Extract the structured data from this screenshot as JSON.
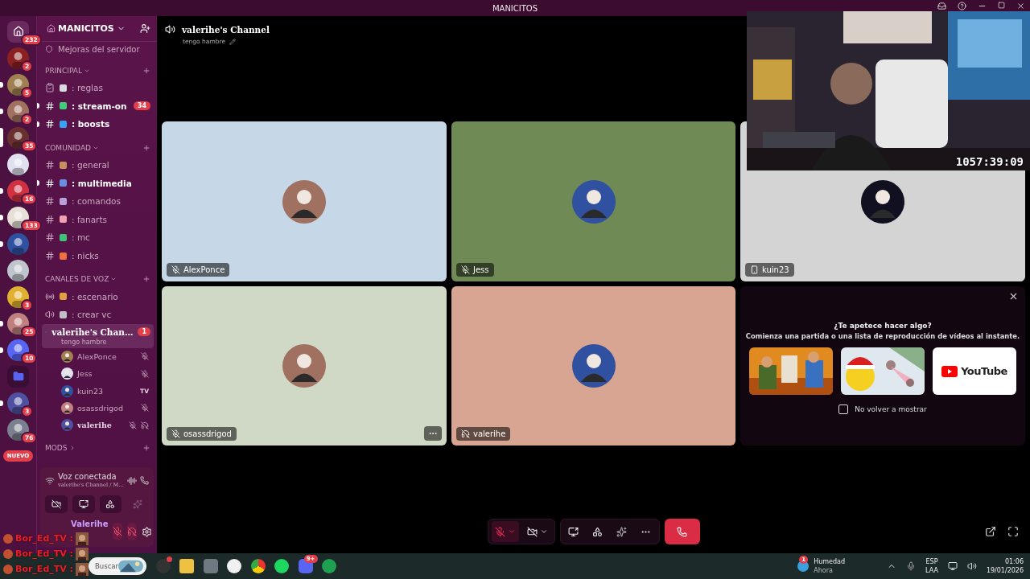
{
  "title_bar": {
    "title": "MANICITOS"
  },
  "servers": [
    {
      "kind": "home",
      "badge": "232",
      "unread": false,
      "selected": false
    },
    {
      "kind": "server",
      "badge": "2",
      "unread": false,
      "selected": false
    },
    {
      "kind": "server",
      "badge": "5",
      "unread": true,
      "selected": false
    },
    {
      "kind": "server",
      "badge": "2",
      "unread": true,
      "selected": false
    },
    {
      "kind": "server",
      "badge": "35",
      "unread": false,
      "selected": true
    },
    {
      "kind": "server",
      "unread": false,
      "selected": false
    },
    {
      "kind": "server",
      "badge": "16",
      "unread": true,
      "selected": false
    },
    {
      "kind": "server",
      "badge": "133",
      "unread": true,
      "selected": false
    },
    {
      "kind": "server",
      "unread": true,
      "selected": false
    },
    {
      "kind": "server",
      "unread": false,
      "selected": false
    },
    {
      "kind": "server",
      "badge": "3",
      "unread": false,
      "selected": false
    },
    {
      "kind": "server",
      "badge": "25",
      "unread": true,
      "selected": false
    },
    {
      "kind": "server",
      "badge": "10",
      "unread": true,
      "selected": false
    },
    {
      "kind": "folder",
      "unread": false,
      "selected": false
    },
    {
      "kind": "server",
      "badge": "3",
      "unread": true,
      "selected": false
    },
    {
      "kind": "server",
      "badge": "76",
      "unread": false,
      "selected": false
    },
    {
      "kind": "new",
      "label": "NUEVO",
      "unread": false,
      "selected": false
    }
  ],
  "server_header": {
    "name": "MANICITOS",
    "boost_link": "Mejoras del servidor"
  },
  "categories": [
    {
      "name": "PRINCIPAL",
      "expanded": true,
      "channels": [
        {
          "kind": "rules",
          "name": ": reglas",
          "color": "#d9d9e0",
          "unread": false
        },
        {
          "kind": "text",
          "name": ": stream-on",
          "color": "#3fcf7a",
          "unread": true,
          "badge": "34"
        },
        {
          "kind": "text",
          "name": ": boosts",
          "color": "#3aa0f0",
          "unread": true
        }
      ]
    },
    {
      "name": "COMUNIDAD",
      "expanded": true,
      "channels": [
        {
          "kind": "text",
          "name": ": general",
          "color": "#c8905a",
          "unread": false
        },
        {
          "kind": "text",
          "name": ": multimedia",
          "color": "#6b8fe0",
          "unread": true
        },
        {
          "kind": "text",
          "name": ": comandos",
          "color": "#b8a0d8",
          "unread": false
        },
        {
          "kind": "text",
          "name": ": fanarts",
          "color": "#f0a0b0",
          "unread": false
        },
        {
          "kind": "text",
          "name": ": mc",
          "color": "#3ec27a",
          "unread": false
        },
        {
          "kind": "text",
          "name": ": nicks",
          "color": "#f07040",
          "unread": false
        }
      ]
    },
    {
      "name": "CANALES DE VOZ",
      "expanded": true,
      "channels": [
        {
          "kind": "stage",
          "name": ": escenario",
          "color": "#e0a040",
          "unread": false
        },
        {
          "kind": "voice",
          "name": ": crear vc",
          "color": "#c0c0c8",
          "unread": false
        },
        {
          "kind": "voice",
          "name": "valerihe's Chan…",
          "selected": true,
          "badge": "1",
          "status": "tengo hambre",
          "unread": false,
          "members": [
            {
              "name": "AlexPonce",
              "muted": true,
              "deafened": false
            },
            {
              "name": "Jess",
              "muted": true,
              "deafened": false
            },
            {
              "name": "kuin23",
              "tag": "TV",
              "muted": false,
              "deafened": false
            },
            {
              "name": "osassdrigod",
              "muted": true,
              "deafened": false
            },
            {
              "name": "valerihe",
              "muted": true,
              "deafened": true
            }
          ]
        }
      ]
    },
    {
      "name": "MODS",
      "expanded": false
    }
  ],
  "voice_panel": {
    "status": "Voz conectada",
    "channel": "valerihe's Channel / M…"
  },
  "user_panel": {
    "name": "Valerihe",
    "muted": true,
    "deafened": true
  },
  "channel_header": {
    "name": "valerihe's Channel",
    "status": "tengo hambre"
  },
  "tiles": [
    {
      "name": "AlexPonce",
      "kind": "muted",
      "color": "#c6d7e7",
      "more": false
    },
    {
      "name": "Jess",
      "kind": "muted",
      "color": "#6f8a54",
      "more": false
    },
    {
      "name": "kuin23",
      "kind": "mobile",
      "color": "#d4d4d4",
      "more": false
    },
    {
      "name": "osassdrigod",
      "kind": "muted",
      "color": "#d0d9c5",
      "more": true
    },
    {
      "name": "valerihe",
      "kind": "deafened",
      "color": "#d8a593",
      "more": false
    }
  ],
  "activity_panel": {
    "title": "¿Te apetece hacer algo?",
    "subtitle": "Comienza una partida o una lista de reproducción de vídeos al instante.",
    "cards": [
      {
        "kind": "picture"
      },
      {
        "kind": "picture"
      },
      {
        "kind": "youtube",
        "label": "YouTube"
      }
    ],
    "dont_show": {
      "label": "No volver a mostrar",
      "checked": false
    }
  },
  "controls": {
    "mic_muted": true,
    "camera_off": true
  },
  "webcam": {
    "kind": "picture",
    "timer": "1057:39:09"
  },
  "chat_overlay": [
    {
      "user": "Bor_Ed_TV :"
    },
    {
      "user": "Bor_Ed_TV :"
    },
    {
      "user": "Bor_Ed_TV :"
    }
  ],
  "taskbar": {
    "search_placeholder": "Buscar",
    "discord_badge": "9+",
    "weather": {
      "badge": "1",
      "title": "Humedad",
      "subtitle": "Ahora"
    },
    "language": {
      "top": "ESP",
      "bottom": "LAA"
    },
    "clock": {
      "time": "01:06",
      "date": "19/01/2026"
    }
  }
}
